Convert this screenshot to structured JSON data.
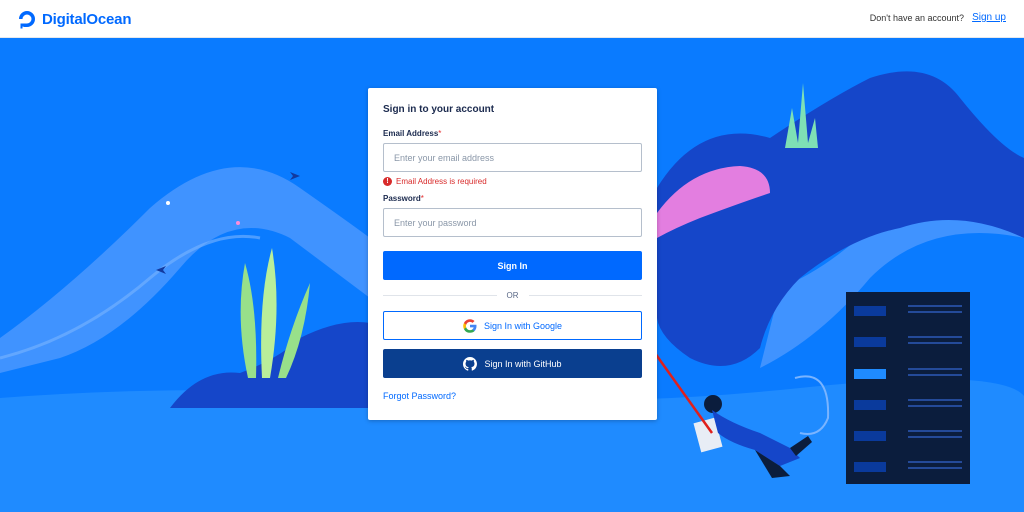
{
  "brand": {
    "name": "DigitalOcean"
  },
  "header": {
    "no_account_text": "Don't have an account?",
    "signup_label": "Sign up"
  },
  "card": {
    "title": "Sign in to your account",
    "email": {
      "label": "Email Address",
      "required_mark": "*",
      "placeholder": "Enter your email address",
      "value": "",
      "error": "Email Address is required"
    },
    "password": {
      "label": "Password",
      "required_mark": "*",
      "placeholder": "Enter your password",
      "value": ""
    },
    "sign_in_label": "Sign In",
    "divider_text": "OR",
    "google_label": "Sign In with Google",
    "github_label": "Sign In with GitHub",
    "forgot_label": "Forgot Password?"
  },
  "colors": {
    "brand_blue": "#0069ff",
    "background_blue": "#0a7bff",
    "github_button": "#0a3f8f",
    "error_red": "#d82b2b",
    "annotation_arrow": "#e0201c"
  },
  "icons": [
    "digitalocean-logo-icon",
    "error-icon",
    "google-icon",
    "github-icon"
  ]
}
